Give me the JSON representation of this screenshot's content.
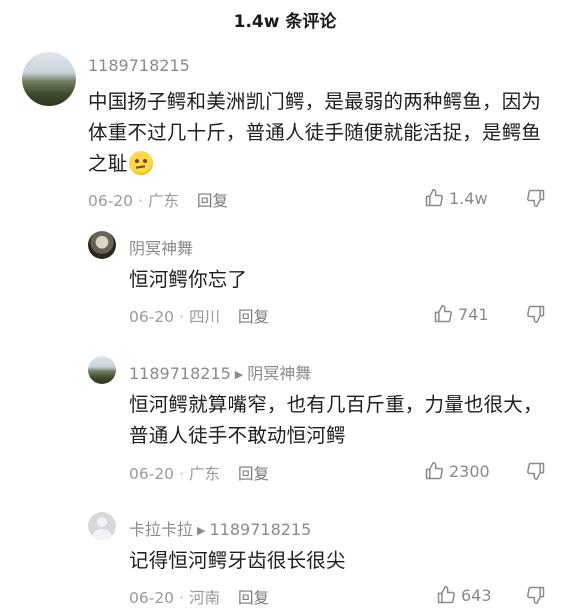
{
  "header": {
    "title": "1.4w 条评论"
  },
  "comments": [
    {
      "username": "1189718215",
      "text": "中国扬子鳄和美洲凯门鳄，是最弱的两种鳄鱼，因为体重不过几十斤，普通人徒手随便就能活捉，是鳄鱼之耻",
      "emoji": "thinking-face",
      "date": "06-20",
      "location": "广东",
      "reply_label": "回复",
      "likes": "1.4w"
    },
    {
      "username": "阴冥神舞",
      "text": "恒河鳄你忘了",
      "date": "06-20",
      "location": "四川",
      "reply_label": "回复",
      "likes": "741"
    },
    {
      "username": "1189718215",
      "reply_to": "阴冥神舞",
      "text": "恒河鳄就算嘴窄，也有几百斤重，力量也很大，普通人徒手不敢动恒河鳄",
      "date": "06-20",
      "location": "广东",
      "reply_label": "回复",
      "likes": "2300"
    },
    {
      "username": "卡拉卡拉",
      "reply_to": "1189718215",
      "text": "记得恒河鳄牙齿很长很尖",
      "date": "06-20",
      "location": "河南",
      "reply_label": "回复",
      "likes": "643"
    }
  ],
  "colors": {
    "text": "#1e1e1e",
    "muted": "#9a9a9a",
    "background": "#ffffff"
  }
}
